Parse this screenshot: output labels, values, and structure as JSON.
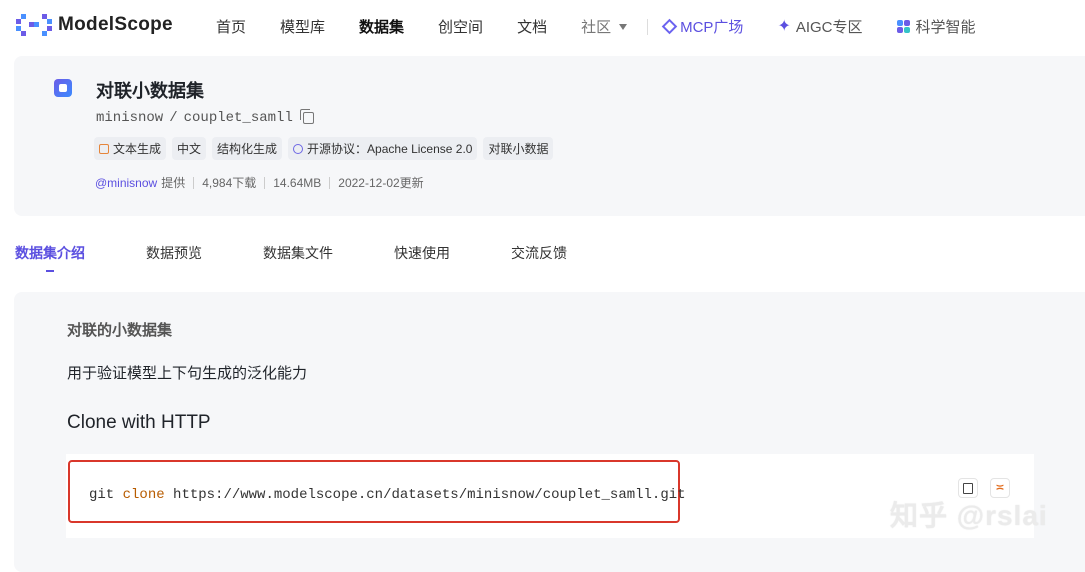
{
  "brand": {
    "name": "ModelScope"
  },
  "nav": {
    "items": [
      "首页",
      "模型库",
      "数据集",
      "创空间",
      "文档"
    ],
    "active": "数据集",
    "community": "社区",
    "specials": [
      {
        "label": "MCP广场",
        "icon": "mcp-diamond-icon"
      },
      {
        "label": "AIGC专区",
        "icon": "sparkle-icon"
      },
      {
        "label": "科学智能",
        "icon": "science-icon"
      }
    ]
  },
  "dataset": {
    "title": "对联小数据集",
    "owner": "minisnow",
    "separator": "/",
    "name": "couplet_samll",
    "tags": [
      "文本生成",
      "中文",
      "结构化生成",
      "开源协议：Apache License 2.0",
      "对联小数据"
    ],
    "meta": {
      "author": "@minisnow",
      "provided": "提供",
      "downloads": "4,984下载",
      "size": "14.64MB",
      "updated": "2022-12-02更新"
    }
  },
  "tabs": [
    "数据集介绍",
    "数据预览",
    "数据集文件",
    "快速使用",
    "交流反馈"
  ],
  "content": {
    "heading": "对联的小数据集",
    "description": "用于验证模型上下句生成的泛化能力",
    "clone_heading": "Clone with HTTP",
    "code": {
      "cmd": "git",
      "keyword": "clone",
      "url": "https://www.modelscope.cn/datasets/minisnow/couplet_samll.git"
    }
  },
  "watermark": "知乎 @rslai",
  "colors": {
    "accent": "#5b4fe0",
    "highlight_border": "#d9372b",
    "card_bg": "#f6f7f9"
  }
}
